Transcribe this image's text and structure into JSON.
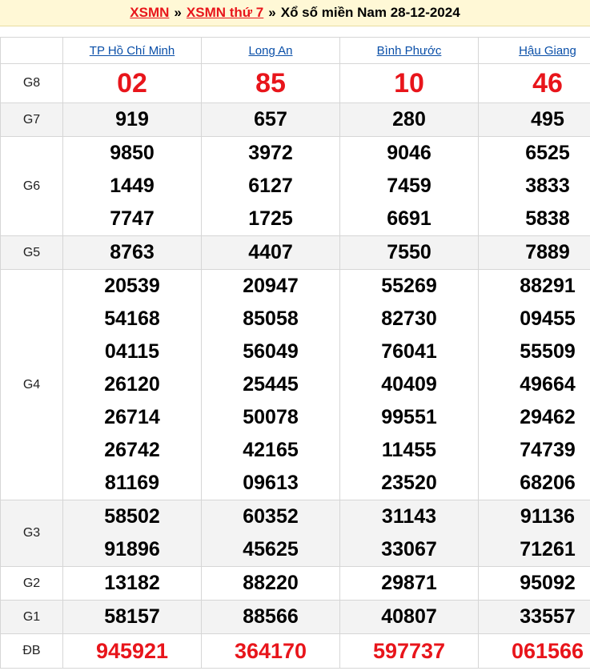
{
  "breadcrumb": {
    "home": "XSMN",
    "separator": "»",
    "day": "XSMN thứ 7",
    "title": "Xổ số miền Nam 28-12-2024"
  },
  "provinces": [
    "TP Hồ Chí Minh",
    "Long An",
    "Bình Phước",
    "Hậu Giang"
  ],
  "prizes": {
    "g8": {
      "label": "G8",
      "values": [
        "02",
        "85",
        "10",
        "46"
      ]
    },
    "g7": {
      "label": "G7",
      "values": [
        "919",
        "657",
        "280",
        "495"
      ]
    },
    "g6": {
      "label": "G6",
      "values": [
        [
          "9850",
          "1449",
          "7747"
        ],
        [
          "3972",
          "6127",
          "1725"
        ],
        [
          "9046",
          "7459",
          "6691"
        ],
        [
          "6525",
          "3833",
          "5838"
        ]
      ]
    },
    "g5": {
      "label": "G5",
      "values": [
        "8763",
        "4407",
        "7550",
        "7889"
      ]
    },
    "g4": {
      "label": "G4",
      "values": [
        [
          "20539",
          "54168",
          "04115",
          "26120",
          "26714",
          "26742",
          "81169"
        ],
        [
          "20947",
          "85058",
          "56049",
          "25445",
          "50078",
          "42165",
          "09613"
        ],
        [
          "55269",
          "82730",
          "76041",
          "40409",
          "99551",
          "11455",
          "23520"
        ],
        [
          "88291",
          "09455",
          "55509",
          "49664",
          "29462",
          "74739",
          "68206"
        ]
      ]
    },
    "g3": {
      "label": "G3",
      "values": [
        [
          "58502",
          "91896"
        ],
        [
          "60352",
          "45625"
        ],
        [
          "31143",
          "33067"
        ],
        [
          "91136",
          "71261"
        ]
      ]
    },
    "g2": {
      "label": "G2",
      "values": [
        "13182",
        "88220",
        "29871",
        "95092"
      ]
    },
    "g1": {
      "label": "G1",
      "values": [
        "58157",
        "88566",
        "40807",
        "33557"
      ]
    },
    "db": {
      "label": "ĐB",
      "values": [
        "945921",
        "364170",
        "597737",
        "061566"
      ]
    }
  },
  "colors": {
    "accent_red": "#e8151b",
    "link_blue": "#0a4fa8",
    "header_bg": "#fff8d6",
    "alt_row": "#f3f3f3"
  }
}
